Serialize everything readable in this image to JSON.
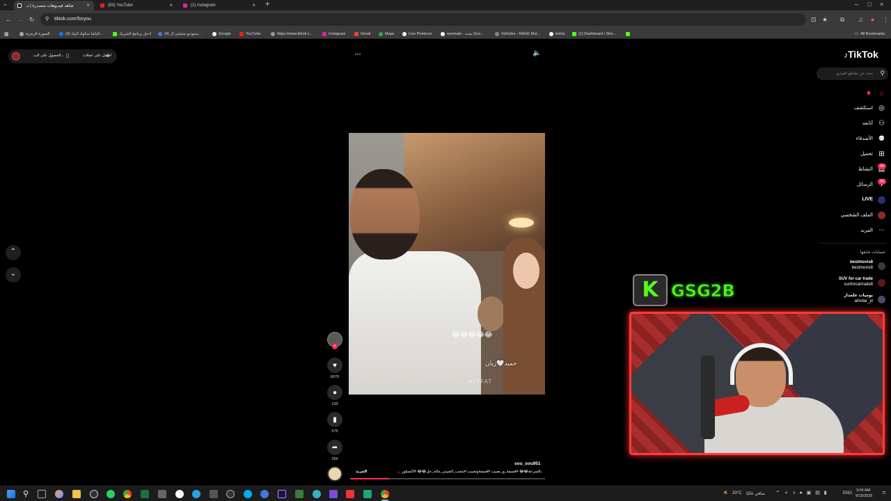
{
  "browser": {
    "tabs": [
      {
        "title": "شاهد فيديوهات متصدرة | تـ",
        "active": true
      },
      {
        "title": "(83) YouTube",
        "active": false
      },
      {
        "title": "(1) Instagram",
        "active": false
      }
    ],
    "url": "tiktok.com/foryou",
    "bookmarks": [
      "الصورة الرمزية",
      "(2) الباشا سكواد البياد...",
      "ادخل برنامج الشريك",
      "(4) ستوديو منشئي ال...",
      "Google",
      "YouTube",
      "https://www.tiktok.c...",
      "Instagram",
      "Gmail",
      "Maps",
      "Live Producer",
      "wormate - يحث Goo...",
      "Vehicles - RAGE Mul...",
      "botrix",
      "(1) Dashboard / Stre..."
    ],
    "all_bookmarks": "All Bookmarks"
  },
  "tiktok": {
    "get_app_label": "الحصول على الت...",
    "get_coins_label": "احصل على عملات",
    "logo": "TikTok",
    "search_placeholder": "بحث عن مقاطع الفيديو",
    "nav": [
      {
        "label": "استكشف",
        "icon": "compass-icon"
      },
      {
        "label": "أتابعه",
        "icon": "following-icon"
      },
      {
        "label": "الأصدقاء",
        "icon": "friends-icon"
      },
      {
        "label": "تحميل",
        "icon": "upload-icon"
      },
      {
        "label": "النشاط",
        "icon": "inbox-icon",
        "badge": "99"
      },
      {
        "label": "الرسائل",
        "icon": "messages-icon",
        "badge": "99"
      },
      {
        "label": "LIVE",
        "icon": "live-icon"
      },
      {
        "label": "الملف الشخصي",
        "icon": "profile-icon"
      },
      {
        "label": "المزيد",
        "icon": "more-icon"
      }
    ],
    "following_header": "حسابات تتابعها",
    "following": [
      {
        "name": "bestmovis8",
        "handle": "bestmovis8"
      },
      {
        "name": "SUV for car trade",
        "handle": "suvforcartrade8"
      },
      {
        "name": "يوميات علمدار",
        "handle": "almdar_yt"
      }
    ],
    "post": {
      "like_count": "6070",
      "comment_count": "133",
      "save_count": "575",
      "share_count": "256",
      "author": "sou_sou951",
      "caption": "بالسرعة😂😂 #قسمة_و_نصيب #قسمةونصيب #شعب_الصيني_ماله_حل😂😂 #اكسبلور ...",
      "more_label": "المزيد",
      "overlay_text": "حميد🤍زيان",
      "overlay_emojis": "😂😂😂😂😂",
      "watermark": "ALTFAT"
    }
  },
  "stream": {
    "brand": "GSG2B"
  },
  "taskbar": {
    "weather": "33°C",
    "weather_desc": "صافي غالبًا",
    "lang": "ENG",
    "time": "3:04 AM",
    "date": "9/15/2025"
  }
}
